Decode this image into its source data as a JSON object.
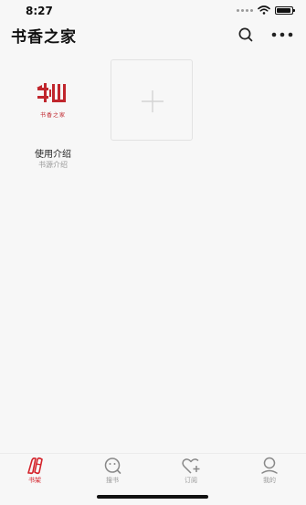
{
  "status_bar": {
    "time": "8:27"
  },
  "header": {
    "title": "书香之家"
  },
  "bookshelf": {
    "items": [
      {
        "cover_text": "书香之家",
        "title": "使用介绍",
        "subtitle": "书源介绍"
      }
    ]
  },
  "tabbar": {
    "items": [
      {
        "label": "书架",
        "icon": "bookshelf-icon",
        "active": true
      },
      {
        "label": "搜书",
        "icon": "search-book-icon",
        "active": false
      },
      {
        "label": "订阅",
        "icon": "subscribe-icon",
        "active": false
      },
      {
        "label": "我的",
        "icon": "profile-icon",
        "active": false
      }
    ]
  },
  "colors": {
    "accent": "#d4232b",
    "background": "#f7f7f7"
  }
}
